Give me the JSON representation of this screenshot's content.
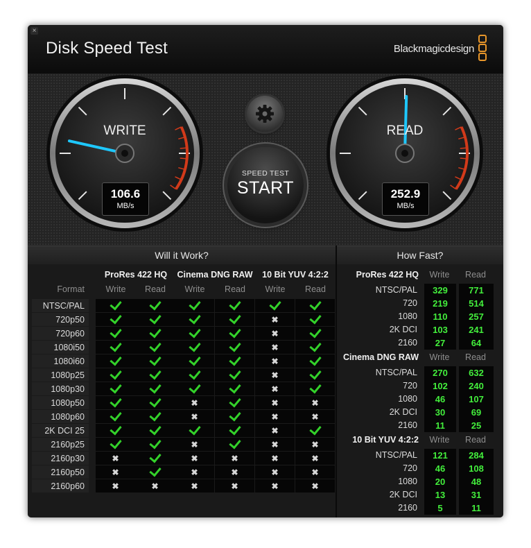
{
  "window": {
    "title": "Disk Speed Test",
    "brand": "Blackmagicdesign",
    "close_glyph": "×"
  },
  "gauges": {
    "write": {
      "label": "WRITE",
      "value": "106.6",
      "unit": "MB/s",
      "needle_value": 106.6
    },
    "read": {
      "label": "READ",
      "value": "252.9",
      "unit": "MB/s",
      "needle_value": 252.9
    },
    "scale_max": 500
  },
  "start_button": {
    "line1": "SPEED TEST",
    "line2": "START"
  },
  "settings_button": {
    "icon": "gear-icon"
  },
  "will_it_work": {
    "title": "Will it Work?",
    "format_header": "Format",
    "groups": [
      "ProRes 422 HQ",
      "Cinema DNG RAW",
      "10 Bit YUV 4:2:2"
    ],
    "sub_headers": [
      "Write",
      "Read",
      "Write",
      "Read",
      "Write",
      "Read"
    ],
    "rows": [
      {
        "format": "NTSC/PAL",
        "support": [
          1,
          1,
          1,
          1,
          1,
          1
        ]
      },
      {
        "format": "720p50",
        "support": [
          1,
          1,
          1,
          1,
          0,
          1
        ]
      },
      {
        "format": "720p60",
        "support": [
          1,
          1,
          1,
          1,
          0,
          1
        ]
      },
      {
        "format": "1080i50",
        "support": [
          1,
          1,
          1,
          1,
          0,
          1
        ]
      },
      {
        "format": "1080i60",
        "support": [
          1,
          1,
          1,
          1,
          0,
          1
        ]
      },
      {
        "format": "1080p25",
        "support": [
          1,
          1,
          1,
          1,
          0,
          1
        ]
      },
      {
        "format": "1080p30",
        "support": [
          1,
          1,
          1,
          1,
          0,
          1
        ]
      },
      {
        "format": "1080p50",
        "support": [
          1,
          1,
          0,
          1,
          0,
          0
        ]
      },
      {
        "format": "1080p60",
        "support": [
          1,
          1,
          0,
          1,
          0,
          0
        ]
      },
      {
        "format": "2K DCI 25",
        "support": [
          1,
          1,
          1,
          1,
          0,
          1
        ]
      },
      {
        "format": "2160p25",
        "support": [
          1,
          1,
          0,
          1,
          0,
          0
        ]
      },
      {
        "format": "2160p30",
        "support": [
          0,
          1,
          0,
          0,
          0,
          0
        ]
      },
      {
        "format": "2160p50",
        "support": [
          0,
          1,
          0,
          0,
          0,
          0
        ]
      },
      {
        "format": "2160p60",
        "support": [
          0,
          0,
          0,
          0,
          0,
          0
        ]
      }
    ]
  },
  "how_fast": {
    "title": "How Fast?",
    "write_header": "Write",
    "read_header": "Read",
    "groups": [
      {
        "name": "ProRes 422 HQ",
        "rows": [
          {
            "format": "NTSC/PAL",
            "write": "329",
            "read": "771"
          },
          {
            "format": "720",
            "write": "219",
            "read": "514"
          },
          {
            "format": "1080",
            "write": "110",
            "read": "257"
          },
          {
            "format": "2K DCI",
            "write": "103",
            "read": "241"
          },
          {
            "format": "2160",
            "write": "27",
            "read": "64"
          }
        ]
      },
      {
        "name": "Cinema DNG RAW",
        "rows": [
          {
            "format": "NTSC/PAL",
            "write": "270",
            "read": "632"
          },
          {
            "format": "720",
            "write": "102",
            "read": "240"
          },
          {
            "format": "1080",
            "write": "46",
            "read": "107"
          },
          {
            "format": "2K DCI",
            "write": "30",
            "read": "69"
          },
          {
            "format": "2160",
            "write": "11",
            "read": "25"
          }
        ]
      },
      {
        "name": "10 Bit YUV 4:2:2",
        "rows": [
          {
            "format": "NTSC/PAL",
            "write": "121",
            "read": "284"
          },
          {
            "format": "720",
            "write": "46",
            "read": "108"
          },
          {
            "format": "1080",
            "write": "20",
            "read": "48"
          },
          {
            "format": "2K DCI",
            "write": "13",
            "read": "31"
          },
          {
            "format": "2160",
            "write": "5",
            "read": "11"
          }
        ]
      }
    ]
  },
  "colors": {
    "accent_green": "#43ef3c",
    "check_green": "#33d12a",
    "needle_cyan": "#1ec8ff",
    "brand_orange": "#e8962a",
    "redline": "#d23a1a"
  }
}
